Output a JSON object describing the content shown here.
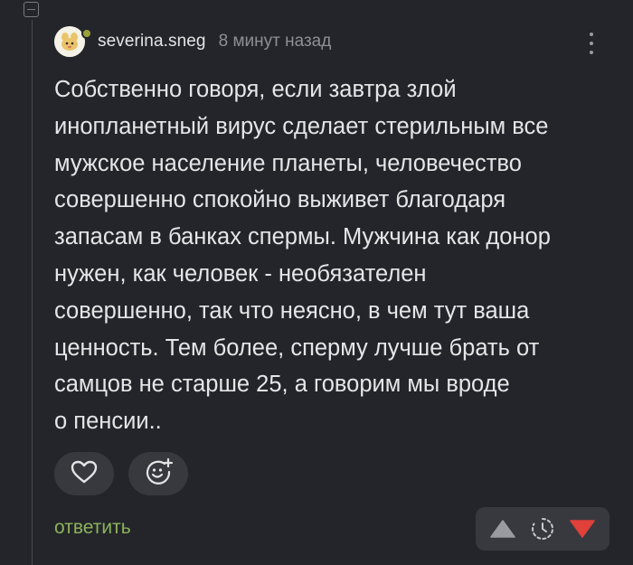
{
  "comment": {
    "author": "severina.sneg",
    "time_ago": "8 минут назад",
    "text": "Собственно говоря, если завтра злой\nинопланетный вирус сделает стерильным все\nмужское население планеты, человечество\nсовершенно спокойно выживет благодаря\nзапасам в банках спермы. Мужчина как донор\nнужен, как человек - необязателен\nсовершенно, так что неясно, в чем тут ваша\nценность. Тем более, сперму лучше брать от\nсамцов не старше 25, а говорим мы вроде\nо пенсии.."
  },
  "actions": {
    "like_icon": "heart-icon",
    "react_icon": "smiley-plus-icon",
    "reply_label": "ответить"
  },
  "rating": {
    "upvote_icon": "triangle-up-icon",
    "pending_icon": "clock-pending-icon",
    "downvote_icon": "triangle-down-icon"
  },
  "colors": {
    "background": "#24252a",
    "button_bg": "#38393e",
    "reply_green": "#8cb35b",
    "upvote_gray": "#9a9ba0",
    "downvote_red": "#e0413a"
  }
}
